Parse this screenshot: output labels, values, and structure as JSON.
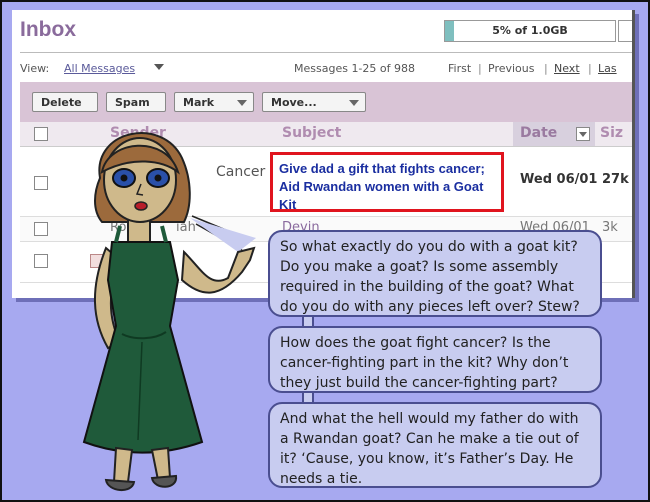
{
  "inbox": {
    "title": "Inbox",
    "quota_label": "5% of 1.0GB",
    "quota_fraction": 0.05,
    "view_label": "View:",
    "view_value": "All Messages",
    "messages_count": "Messages 1-25 of 988",
    "nav_first": "First",
    "nav_sep": "|",
    "nav_previous": "Previous",
    "nav_next": "Next",
    "nav_last": "Las"
  },
  "toolbar": {
    "delete_label": "Delete",
    "spam_label": "Spam",
    "mark_label": "Mark",
    "move_label": "Move..."
  },
  "columns": {
    "sender": "Sender",
    "subject": "Subject",
    "date": "Date",
    "size": "Siz"
  },
  "rows": [
    {
      "sender": "Cancer",
      "subject": "Give dad a gift that fights cancer; Aid Rwandan women with a Goat Kit",
      "date": "Wed 06/01",
      "size": "27k"
    },
    {
      "sender": "Rose",
      "sender_tail": "iah",
      "subject": "Devin",
      "date": "Wed 06/01",
      "size": "3k"
    },
    {
      "sender": "",
      "subject": "",
      "date": "",
      "size": ""
    }
  ],
  "speech": [
    "So what exactly do you do with a goat kit? Do you make a goat? Is some assembly required in the building of the goat? What do you do with any pieces left over? Stew?",
    "How does the goat fight cancer? Is the cancer-fighting part in the kit? Why don’t they just build the cancer-fighting part?",
    "And what the hell would my father do with a Rwandan goat? Can he make a tie out of it?  ‘Cause, you know, it’s Father’s Day. He needs a tie."
  ],
  "colors": {
    "background": "#a7a9f0",
    "bubble": "#c8ccf0",
    "highlight_border": "#e0141e",
    "subject_link": "#1a2ea0",
    "dress": "#1f5a3a"
  }
}
